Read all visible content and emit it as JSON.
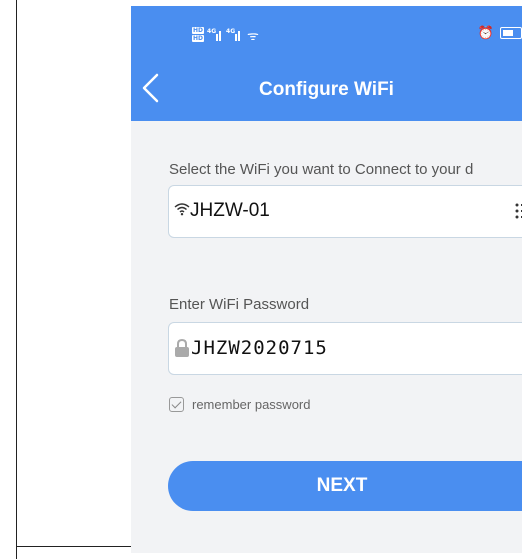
{
  "header": {
    "title": "Configure WiFi"
  },
  "status_bar": {
    "sim1": "HD",
    "sim2": "HD",
    "net1": "4G",
    "net2": "4G"
  },
  "wifi_section": {
    "label": "Select the WiFi you want to Connect to your d",
    "ssid": "JHZW-01"
  },
  "password_section": {
    "label": "Enter WiFi Password",
    "password": "JHZW2020715"
  },
  "remember": {
    "label": "remember password",
    "checked": true
  },
  "next_button": {
    "label": "NEXT"
  },
  "colors": {
    "accent": "#4a8ef0",
    "background": "#f2f3f5",
    "eye_icon": "#6bc4c8"
  }
}
